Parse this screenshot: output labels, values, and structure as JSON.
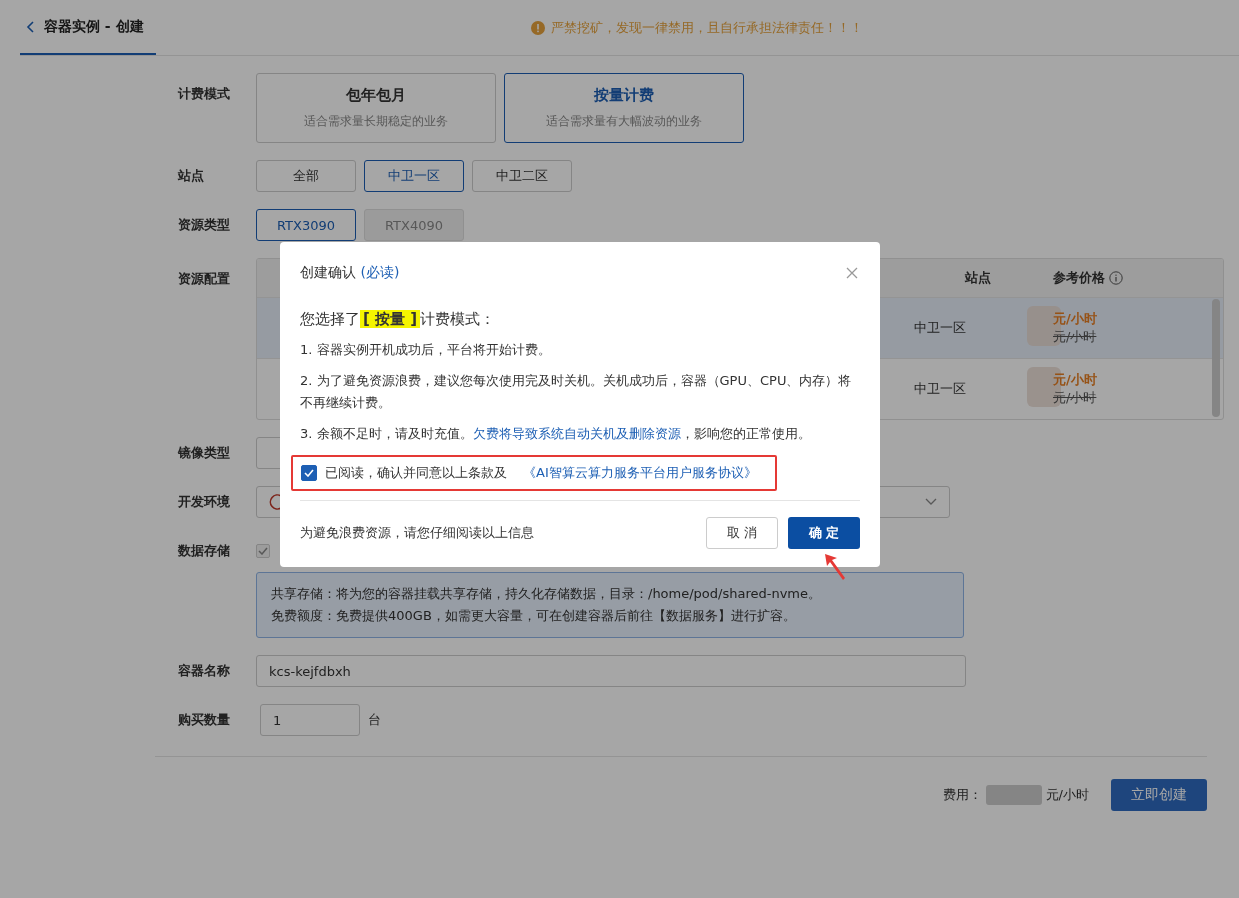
{
  "header": {
    "back_label": "容器实例 - 创建",
    "warning": "严禁挖矿，发现一律禁用，且自行承担法律责任！！！"
  },
  "form": {
    "billing": {
      "label": "计费模式",
      "options": [
        {
          "title": "包年包月",
          "desc": "适合需求量长期稳定的业务",
          "selected": false
        },
        {
          "title": "按量计费",
          "desc": "适合需求量有大幅波动的业务",
          "selected": true
        }
      ]
    },
    "site": {
      "label": "站点",
      "options": [
        {
          "label": "全部",
          "selected": false
        },
        {
          "label": "中卫一区",
          "selected": true
        },
        {
          "label": "中卫二区",
          "selected": false
        }
      ]
    },
    "resource_type": {
      "label": "资源类型",
      "options": [
        {
          "label": "RTX3090",
          "selected": true,
          "disabled": false
        },
        {
          "label": "RTX4090",
          "selected": false,
          "disabled": true
        }
      ]
    },
    "resource_config": {
      "label": "资源配置",
      "columns": [
        "站点",
        "参考价格"
      ],
      "rows": [
        {
          "site": "中卫一区",
          "price": "元/小时",
          "original_price": "元/小时",
          "selected": true
        },
        {
          "site": "中卫一区",
          "price": "元/小时",
          "original_price": "元/小时",
          "selected": false
        }
      ]
    },
    "image_type": {
      "label": "镜像类型"
    },
    "dev_env": {
      "label": "开发环境"
    },
    "storage": {
      "label": "数据存储",
      "checked": true,
      "info": [
        "共享存储：将为您的容器挂载共享存储，持久化存储数据，目录：/home/pod/shared-nvme。",
        "免费额度：免费提供400GB，如需更大容量，可在创建容器后前往【数据服务】进行扩容。"
      ]
    },
    "name": {
      "label": "容器名称",
      "value": "kcs-kejfdbxh"
    },
    "quantity": {
      "label": "购买数量",
      "value": "1",
      "unit": "台"
    }
  },
  "footer": {
    "fee_label": "费用：",
    "fee_unit": "元/小时",
    "submit": "立即创建"
  },
  "dialog": {
    "title": "创建确认",
    "title_note": "(必读)",
    "intro_before": "您选择了",
    "intro_mode": "[ 按量 ]",
    "intro_after": "计费模式：",
    "items": [
      {
        "text": "1. 容器实例开机成功后，平台将开始计费。"
      },
      {
        "text": "2. 为了避免资源浪费，建议您每次使用完及时关机。关机成功后，容器（GPU、CPU、内存）将不再继续计费。"
      },
      {
        "text": "3. 余额不足时，请及时充值。",
        "link": "欠费将导致系统自动关机及删除资源",
        "after": "，影响您的正常使用。"
      }
    ],
    "agree": {
      "checked": true,
      "text": "已阅读，确认并同意以上条款及",
      "link": "《AI智算云算力服务平台用户服务协议》"
    },
    "footer_note": "为避免浪费资源，请您仔细阅读以上信息",
    "cancel": "取 消",
    "confirm": "确 定"
  }
}
